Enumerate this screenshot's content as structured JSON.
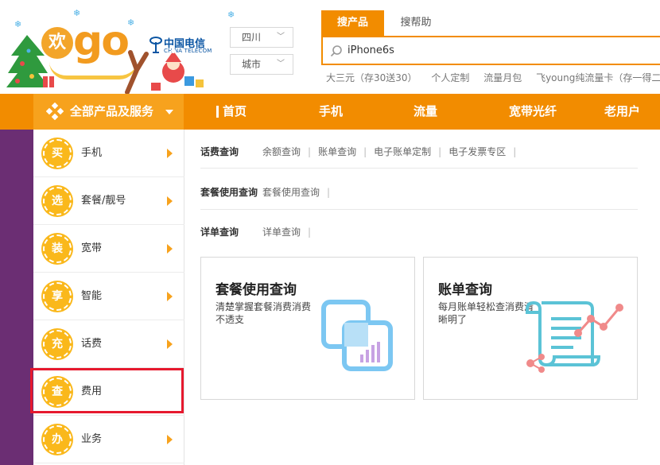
{
  "header": {
    "brand_char": "欢",
    "brand_word": "go",
    "carrier_name": "中国电信",
    "carrier_sub": "CHINA TELECOM",
    "province_select": "四川",
    "city_select": "城市"
  },
  "search": {
    "tab_products": "搜产品",
    "tab_help": "搜帮助",
    "value": "iPhone6s",
    "hotwords": [
      "大三元（存30送30）",
      "个人定制",
      "流量月包",
      "飞young纯流量卡（存一得二购"
    ]
  },
  "nav": {
    "all_products": "全部产品及服务",
    "items": [
      "首页",
      "手机",
      "流量",
      "宽带光纤",
      "老用户"
    ]
  },
  "sidebar": {
    "items": [
      {
        "badge": "买",
        "label": "手机",
        "arrow": true
      },
      {
        "badge": "选",
        "label": "套餐/靓号",
        "arrow": true
      },
      {
        "badge": "装",
        "label": "宽带",
        "arrow": true
      },
      {
        "badge": "享",
        "label": "智能",
        "arrow": true
      },
      {
        "badge": "充",
        "label": "话费",
        "arrow": true
      },
      {
        "badge": "查",
        "label": "费用",
        "arrow": false
      },
      {
        "badge": "办",
        "label": "业务",
        "arrow": true
      }
    ],
    "selected_index": 5,
    "highlight_color": "#e6192e"
  },
  "queries": [
    {
      "title": "话费查询",
      "links": [
        "余额查询",
        "账单查询",
        "电子账单定制",
        "电子发票专区"
      ]
    },
    {
      "title": "套餐使用查询",
      "links": [
        "套餐使用查询"
      ]
    },
    {
      "title": "详单查询",
      "links": [
        "详单查询"
      ]
    }
  ],
  "cards": [
    {
      "title": "套餐使用查询",
      "desc": "清楚掌握套餐消费消费不透支",
      "icon": "package-usage-icon"
    },
    {
      "title": "账单查询",
      "desc": "每月账单轻松查消费清晰明了",
      "icon": "bill-scroll-icon"
    }
  ],
  "colors": {
    "brand_orange": "#f28c00",
    "nav_light_orange": "#f7a21d",
    "badge_yellow": "#fab81b",
    "purple": "#6b2e73",
    "carrier_blue": "#0a55a3"
  }
}
